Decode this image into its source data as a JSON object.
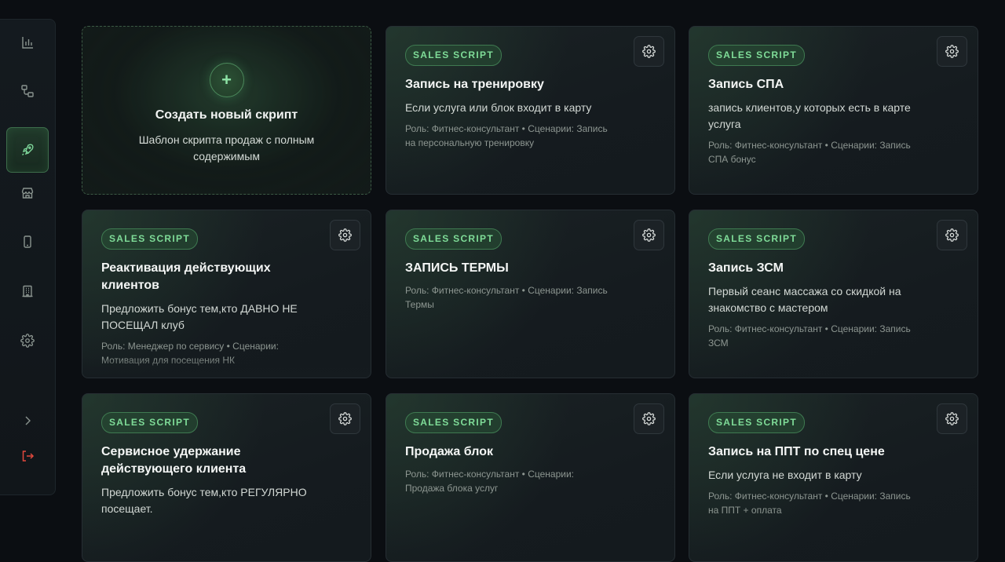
{
  "sidebar": {
    "items": [
      {
        "name": "chart-icon"
      },
      {
        "name": "workflow-icon"
      },
      {
        "name": "rocket-icon"
      },
      {
        "name": "store-icon"
      },
      {
        "name": "phone-icon"
      },
      {
        "name": "building-icon"
      },
      {
        "name": "gear-icon"
      }
    ],
    "expand_icon": "chevron-right-icon",
    "logout_icon": "logout-icon"
  },
  "create_card": {
    "plus": "+",
    "title": "Создать новый скрипт",
    "subtitle": "Шаблон скрипта продаж с полным содержимым"
  },
  "cards": [
    {
      "badge": "SALES SCRIPT",
      "title": "Запись на тренировку",
      "desc": "Если услуга или блок входит в карту",
      "meta": "Роль: Фитнес-консультант • Сценарии: Запись на персональную тренировку"
    },
    {
      "badge": "SALES SCRIPT",
      "title": "Запись СПА",
      "desc": "запись клиентов,у которых есть в карте услуга",
      "meta": "Роль: Фитнес-консультант • Сценарии: Запись СПА бонус"
    },
    {
      "badge": "SALES SCRIPT",
      "title": "Реактивация действующих клиентов",
      "desc": "Предложить бонус тем,кто ДАВНО НЕ ПОСЕЩАЛ клуб",
      "meta": "Роль: Менеджер по сервису • Сценарии: Мотивация для посещения НК"
    },
    {
      "badge": "SALES SCRIPT",
      "title": "ЗАПИСЬ ТЕРМЫ",
      "desc": "",
      "meta": "Роль: Фитнес-консультант • Сценарии: Запись Термы"
    },
    {
      "badge": "SALES SCRIPT",
      "title": "Запись ЗСМ",
      "desc": "Первый сеанс массажа со скидкой на знакомство с мастером",
      "meta": "Роль: Фитнес-консультант • Сценарии: Запись ЗСМ"
    },
    {
      "badge": "SALES SCRIPT",
      "title": "Сервисное удержание действующего клиента",
      "desc": "Предложить бонус тем,кто РЕГУЛЯРНО посещает.",
      "meta": ""
    },
    {
      "badge": "SALES SCRIPT",
      "title": "Продажа блок",
      "desc": "",
      "meta": "Роль: Фитнес-консультант • Сценарии: Продажа блока услуг"
    },
    {
      "badge": "SALES SCRIPT",
      "title": "Запись на ППТ по спец цене",
      "desc": "Если услуга не входит в карту",
      "meta": "Роль: Фитнес-консультант • Сценарии: Запись на ППТ + оплата"
    }
  ],
  "colors": {
    "accent": "#7fdc98",
    "logout": "#e2483d",
    "background": "#0b0e12"
  }
}
